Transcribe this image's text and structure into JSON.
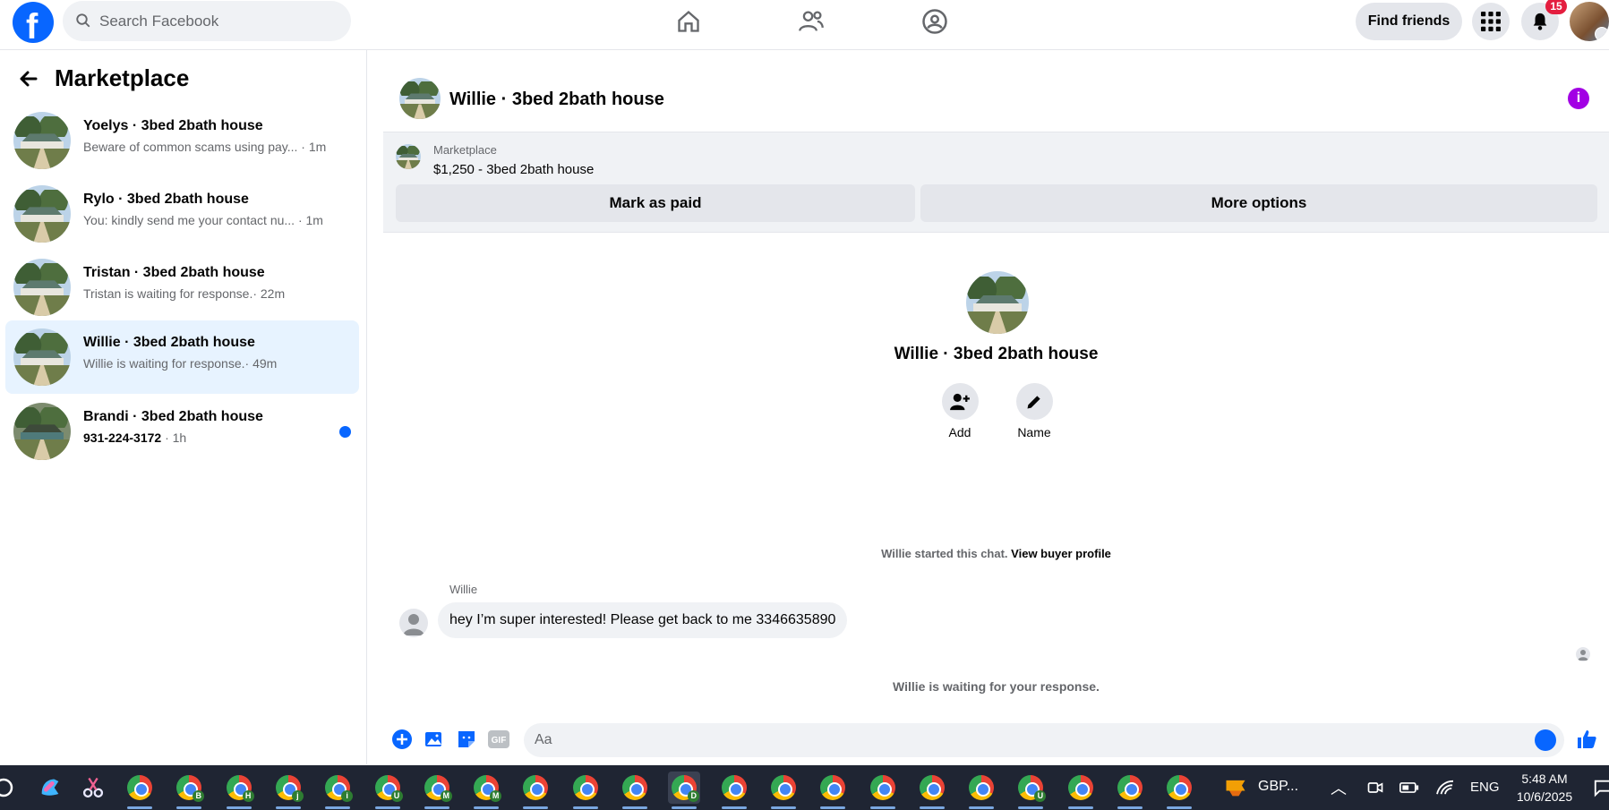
{
  "topbar": {
    "logo": "f",
    "search_placeholder": "Search Facebook",
    "find_friends": "Find friends",
    "notification_count": "15",
    "nav_icons": [
      "home-icon",
      "friends-icon",
      "groups-icon"
    ]
  },
  "sidebar": {
    "title": "Marketplace",
    "conversations": [
      {
        "name": "Yoelys · 3bed 2bath house",
        "preview": "Beware of common scams using pay...",
        "time": "· 1m",
        "unread": false,
        "active": false
      },
      {
        "name": "Rylo · 3bed 2bath house",
        "preview": "You: kindly send me your contact nu...",
        "time": "· 1m",
        "unread": false,
        "active": false
      },
      {
        "name": "Tristan · 3bed 2bath house",
        "preview": "Tristan is waiting for response.",
        "time": "· 22m",
        "unread": false,
        "active": false
      },
      {
        "name": "Willie · 3bed 2bath house",
        "preview": "Willie is waiting for response.",
        "time": "· 49m",
        "unread": false,
        "active": true
      },
      {
        "name": "Brandi · 3bed 2bath house",
        "preview": "931-224-3172",
        "time": " · 1h",
        "unread": true,
        "active": false
      }
    ]
  },
  "chat": {
    "title": "Willie · 3bed 2bath house",
    "listing": {
      "source": "Marketplace",
      "price_title": "$1,250 - 3bed 2bath house",
      "mark_paid": "Mark as paid",
      "more_options": "More options"
    },
    "profile": {
      "name": "Willie · 3bed 2bath house",
      "add_label": "Add",
      "name_label": "Name"
    },
    "started_text": "Willie started this chat.",
    "view_profile": "View buyer profile",
    "sender": "Willie",
    "message": "hey I’m super interested! Please get back to me 3346635890",
    "waiting": "Willie is waiting for your response.",
    "composer_placeholder": "Aa",
    "gif_label": "GIF"
  },
  "taskbar": {
    "tray_label": "GBP...",
    "language": "ENG",
    "time": "5:48 AM",
    "date": "10/6/2025",
    "chrome_profiles": [
      "",
      "B",
      "H",
      "j",
      "i",
      "U",
      "M",
      "M",
      "",
      "",
      "",
      "D",
      "",
      "",
      "",
      "",
      "",
      "",
      "U",
      "",
      "",
      ""
    ]
  },
  "colors": {
    "brand": "#0866ff",
    "info": "#a200e4",
    "badge": "#e41e3f",
    "active_row": "#e7f3ff"
  }
}
